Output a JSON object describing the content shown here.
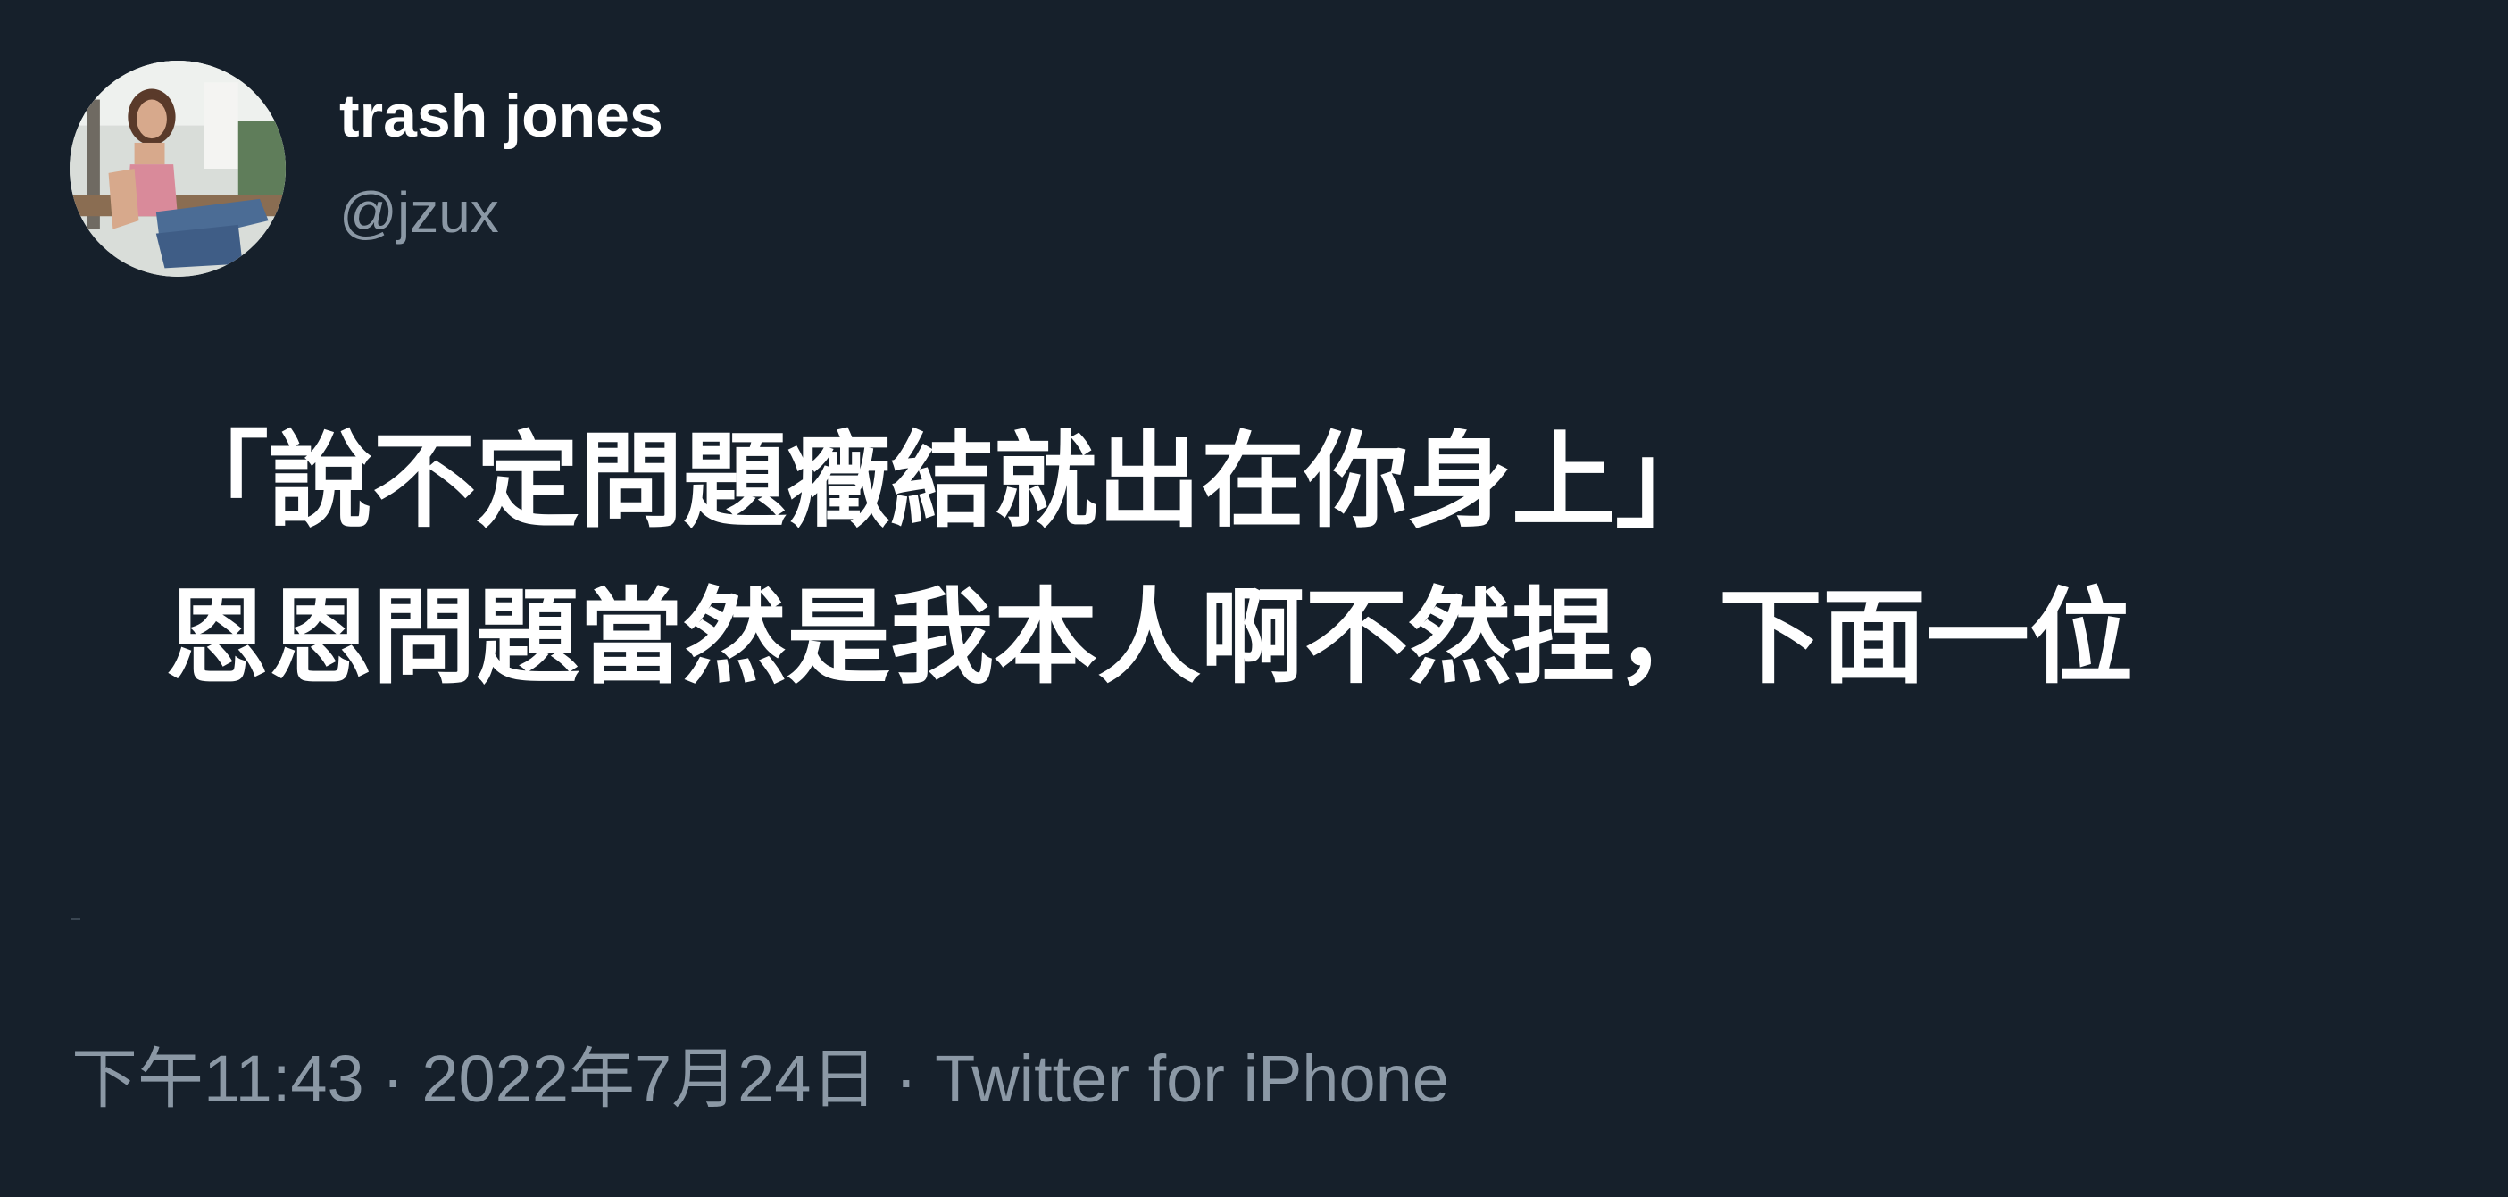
{
  "user": {
    "display_name": "trash jones",
    "handle": "@jzux"
  },
  "tweet": {
    "lines": [
      "「說不定問題癥結就出在你身上」",
      "恩恩問題當然是我本人啊不然捏，下面一位"
    ]
  },
  "meta": {
    "time": "下午11:43",
    "separator": "·",
    "date": "2022年7月24日",
    "source": "Twitter for iPhone"
  },
  "colors": {
    "background": "#16202b",
    "text_primary": "#ffffff",
    "text_secondary": "#8b98a5"
  }
}
